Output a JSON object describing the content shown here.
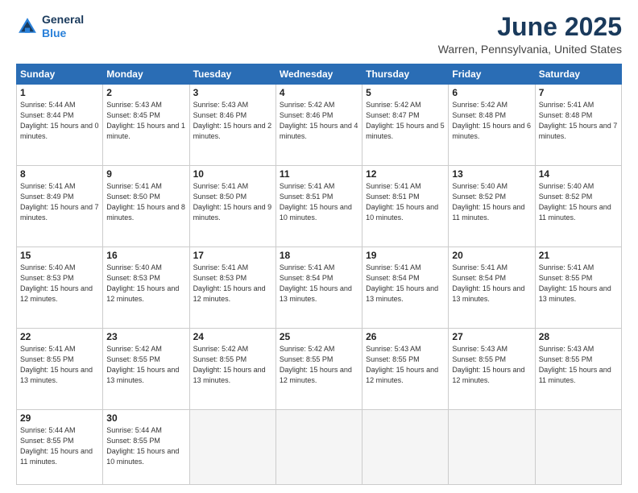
{
  "header": {
    "logo_line1": "General",
    "logo_line2": "Blue",
    "month_title": "June 2025",
    "location": "Warren, Pennsylvania, United States"
  },
  "days_of_week": [
    "Sunday",
    "Monday",
    "Tuesday",
    "Wednesday",
    "Thursday",
    "Friday",
    "Saturday"
  ],
  "weeks": [
    [
      {
        "day": "1",
        "sunrise": "5:44 AM",
        "sunset": "8:44 PM",
        "daylight": "15 hours and 0 minutes."
      },
      {
        "day": "2",
        "sunrise": "5:43 AM",
        "sunset": "8:45 PM",
        "daylight": "15 hours and 1 minute."
      },
      {
        "day": "3",
        "sunrise": "5:43 AM",
        "sunset": "8:46 PM",
        "daylight": "15 hours and 2 minutes."
      },
      {
        "day": "4",
        "sunrise": "5:42 AM",
        "sunset": "8:46 PM",
        "daylight": "15 hours and 4 minutes."
      },
      {
        "day": "5",
        "sunrise": "5:42 AM",
        "sunset": "8:47 PM",
        "daylight": "15 hours and 5 minutes."
      },
      {
        "day": "6",
        "sunrise": "5:42 AM",
        "sunset": "8:48 PM",
        "daylight": "15 hours and 6 minutes."
      },
      {
        "day": "7",
        "sunrise": "5:41 AM",
        "sunset": "8:48 PM",
        "daylight": "15 hours and 7 minutes."
      }
    ],
    [
      {
        "day": "8",
        "sunrise": "5:41 AM",
        "sunset": "8:49 PM",
        "daylight": "15 hours and 7 minutes."
      },
      {
        "day": "9",
        "sunrise": "5:41 AM",
        "sunset": "8:50 PM",
        "daylight": "15 hours and 8 minutes."
      },
      {
        "day": "10",
        "sunrise": "5:41 AM",
        "sunset": "8:50 PM",
        "daylight": "15 hours and 9 minutes."
      },
      {
        "day": "11",
        "sunrise": "5:41 AM",
        "sunset": "8:51 PM",
        "daylight": "15 hours and 10 minutes."
      },
      {
        "day": "12",
        "sunrise": "5:41 AM",
        "sunset": "8:51 PM",
        "daylight": "15 hours and 10 minutes."
      },
      {
        "day": "13",
        "sunrise": "5:40 AM",
        "sunset": "8:52 PM",
        "daylight": "15 hours and 11 minutes."
      },
      {
        "day": "14",
        "sunrise": "5:40 AM",
        "sunset": "8:52 PM",
        "daylight": "15 hours and 11 minutes."
      }
    ],
    [
      {
        "day": "15",
        "sunrise": "5:40 AM",
        "sunset": "8:53 PM",
        "daylight": "15 hours and 12 minutes."
      },
      {
        "day": "16",
        "sunrise": "5:40 AM",
        "sunset": "8:53 PM",
        "daylight": "15 hours and 12 minutes."
      },
      {
        "day": "17",
        "sunrise": "5:41 AM",
        "sunset": "8:53 PM",
        "daylight": "15 hours and 12 minutes."
      },
      {
        "day": "18",
        "sunrise": "5:41 AM",
        "sunset": "8:54 PM",
        "daylight": "15 hours and 13 minutes."
      },
      {
        "day": "19",
        "sunrise": "5:41 AM",
        "sunset": "8:54 PM",
        "daylight": "15 hours and 13 minutes."
      },
      {
        "day": "20",
        "sunrise": "5:41 AM",
        "sunset": "8:54 PM",
        "daylight": "15 hours and 13 minutes."
      },
      {
        "day": "21",
        "sunrise": "5:41 AM",
        "sunset": "8:55 PM",
        "daylight": "15 hours and 13 minutes."
      }
    ],
    [
      {
        "day": "22",
        "sunrise": "5:41 AM",
        "sunset": "8:55 PM",
        "daylight": "15 hours and 13 minutes."
      },
      {
        "day": "23",
        "sunrise": "5:42 AM",
        "sunset": "8:55 PM",
        "daylight": "15 hours and 13 minutes."
      },
      {
        "day": "24",
        "sunrise": "5:42 AM",
        "sunset": "8:55 PM",
        "daylight": "15 hours and 13 minutes."
      },
      {
        "day": "25",
        "sunrise": "5:42 AM",
        "sunset": "8:55 PM",
        "daylight": "15 hours and 12 minutes."
      },
      {
        "day": "26",
        "sunrise": "5:43 AM",
        "sunset": "8:55 PM",
        "daylight": "15 hours and 12 minutes."
      },
      {
        "day": "27",
        "sunrise": "5:43 AM",
        "sunset": "8:55 PM",
        "daylight": "15 hours and 12 minutes."
      },
      {
        "day": "28",
        "sunrise": "5:43 AM",
        "sunset": "8:55 PM",
        "daylight": "15 hours and 11 minutes."
      }
    ],
    [
      {
        "day": "29",
        "sunrise": "5:44 AM",
        "sunset": "8:55 PM",
        "daylight": "15 hours and 11 minutes."
      },
      {
        "day": "30",
        "sunrise": "5:44 AM",
        "sunset": "8:55 PM",
        "daylight": "15 hours and 10 minutes."
      },
      null,
      null,
      null,
      null,
      null
    ]
  ]
}
